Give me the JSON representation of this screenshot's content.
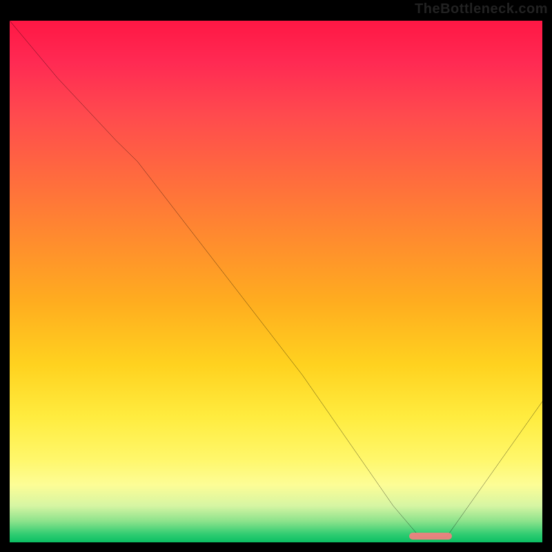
{
  "watermark": "TheBottleneck.com",
  "chart_data": {
    "type": "line",
    "title": "",
    "xlabel": "",
    "ylabel": "",
    "xlim": [
      0,
      100
    ],
    "ylim": [
      0,
      100
    ],
    "x": [
      0,
      9,
      20,
      24,
      55,
      72,
      77,
      82,
      100
    ],
    "values": [
      100,
      89,
      77,
      73,
      32,
      7,
      1,
      1,
      27
    ],
    "marker": {
      "x_start": 75,
      "x_end": 83,
      "y": 1
    },
    "background_gradient": {
      "top": "#ff1744",
      "mid": "#ffd21f",
      "bottom": "#0bbf63"
    }
  },
  "colors": {
    "curve": "#000000",
    "marker": "#f08080",
    "frame": "#000000"
  }
}
